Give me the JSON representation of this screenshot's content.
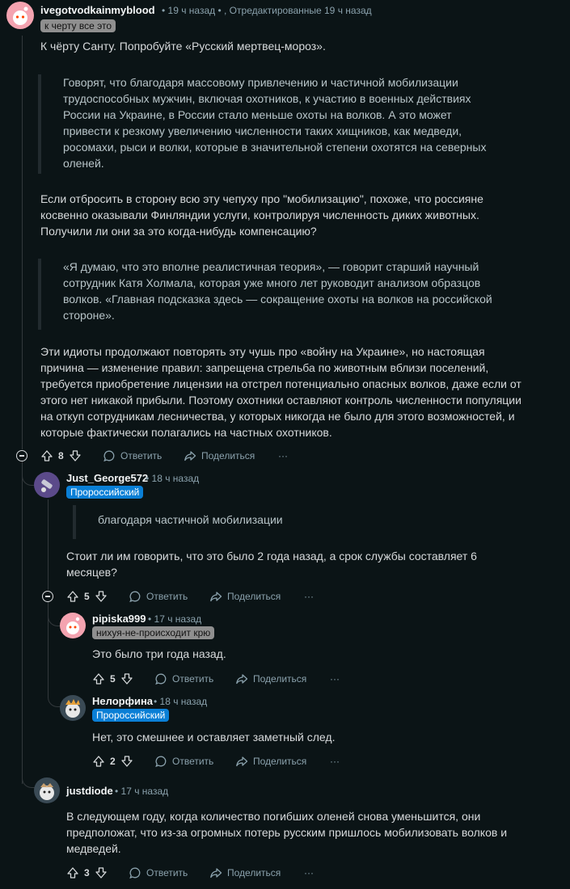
{
  "comments": [
    {
      "author": "ivegotvodkainmyblood",
      "meta": "• 19 ч назад • , Отредактированные 19 ч назад",
      "flair": "к черту все это",
      "paragraphs": [
        "К чёрту Санту. Попробуйте «Русский мертвец-мороз».",
        "Если отбросить в сторону всю эту чепуху про \"мобилизацию\", похоже, что россияне косвенно оказывали Финляндии услуги, контролируя численность диких животных. Получили ли они за это когда-нибудь компенсацию?",
        "Эти идиоты продолжают повторять эту чушь про «войну на Украине», но настоящая причина — изменение правил: запрещена стрельба по животным вблизи поселений, требуется приобретение лицензии на отстрел потенциально опасных волков, даже если от этого нет никакой прибыли. Поэтому охотники оставляют контроль численности популяции на откуп сотрудникам лесничества, у которых никогда не было для этого возможностей, и которые фактически полагались на частных охотников."
      ],
      "quotes": [
        "Говорят, что благодаря массовому привлечению и частичной мобилизации трудоспособных мужчин, включая охотников, к участию в военных действиях России на Украине, в России стало меньше охоты на волков. А это может привести к резкому увеличению численности таких хищников, как медведи, росомахи, рыси и волки, которые в значительной степени охотятся на северных оленей.",
        "«Я думаю, что это вполне реалистичная теория», — говорит старший научный сотрудник Катя Холмала, которая уже много лет руководит анализом образцов волков. «Главная подсказка здесь — сокращение охоты на волков на российской стороне»."
      ],
      "votes": "8"
    },
    {
      "author": "Just_George572",
      "meta": "• 18 ч назад",
      "flair": "Пророссийский",
      "quote": "благодаря частичной мобилизации",
      "text": "Стоит ли им говорить, что это было 2 года назад, а срок службы составляет 6 месяцев?",
      "votes": "5"
    },
    {
      "author": "pipiska999",
      "meta": "• 17 ч назад",
      "flair": "нихуя-не-происходит крю",
      "text": "Это было три года назад.",
      "votes": "5"
    },
    {
      "author": "Нелорфина",
      "meta": "• 18 ч назад",
      "flair": "Пророссийский",
      "text": "Нет, это смешнее и оставляет заметный след.",
      "votes": "2"
    },
    {
      "author": "justdiode",
      "meta": "• 17 ч назад",
      "text": "В следующем году, когда количество погибших оленей снова уменьшится, они предположат, что из-за огромных потерь русским пришлось мобилизовать волков и медведей.",
      "votes": "3"
    }
  ],
  "actions": {
    "reply": "Ответить",
    "share": "Поделиться",
    "more": "···"
  },
  "colors": {
    "background": "#0b1416",
    "flair_blue": "#0a7fd6",
    "flair_gray": "#8f8f8f"
  }
}
